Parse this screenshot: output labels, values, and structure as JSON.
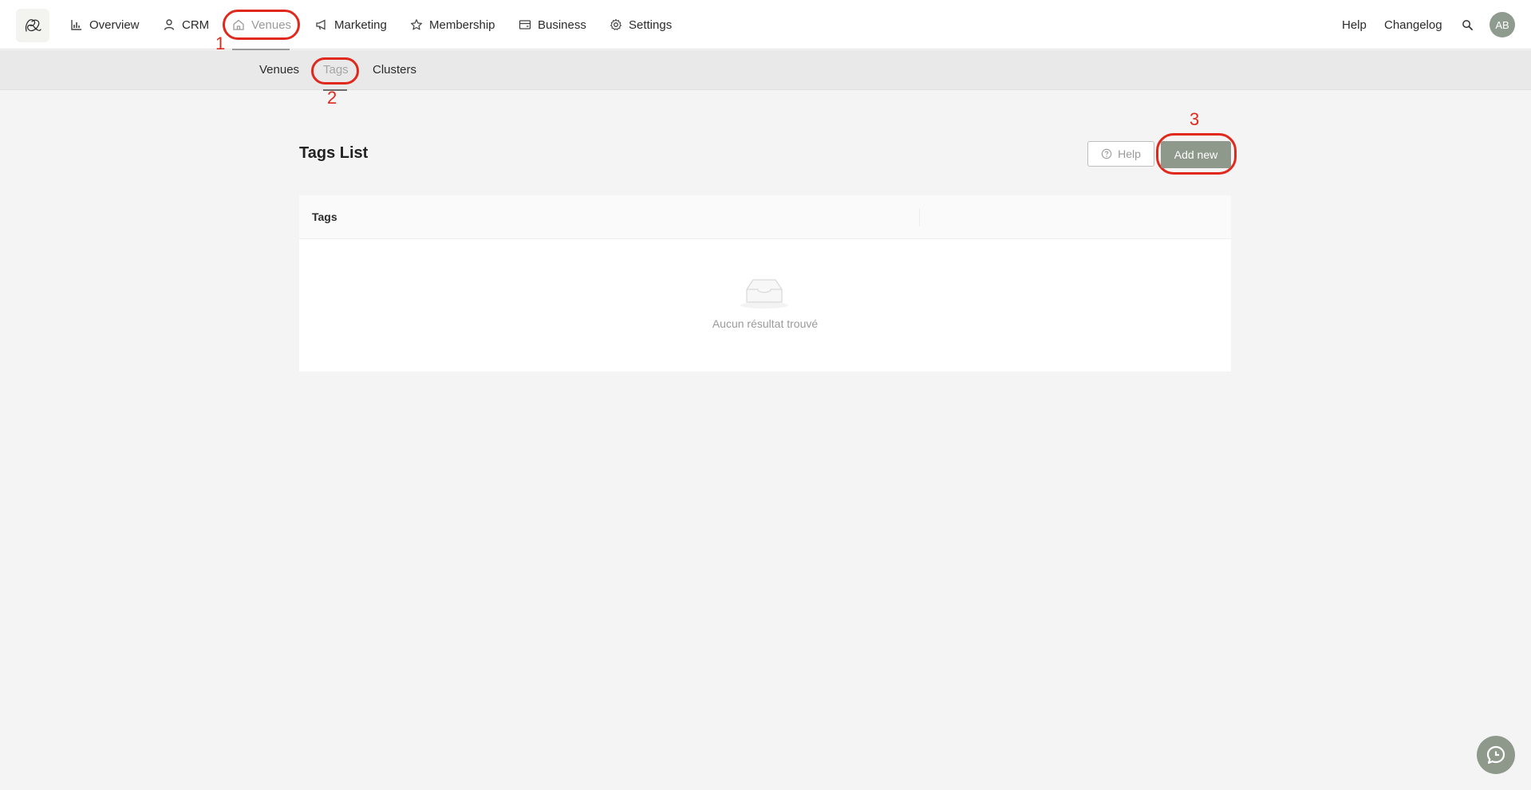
{
  "topnav": {
    "items": [
      {
        "label": "Overview",
        "icon": "chart-icon"
      },
      {
        "label": "CRM",
        "icon": "user-icon"
      },
      {
        "label": "Venues",
        "icon": "home-icon",
        "active": true
      },
      {
        "label": "Marketing",
        "icon": "megaphone-icon"
      },
      {
        "label": "Membership",
        "icon": "star-icon"
      },
      {
        "label": "Business",
        "icon": "card-icon"
      },
      {
        "label": "Settings",
        "icon": "gear-icon"
      }
    ],
    "help_label": "Help",
    "changelog_label": "Changelog",
    "avatar_initials": "AB"
  },
  "subnav": {
    "items": [
      {
        "label": "Venues"
      },
      {
        "label": "Tags",
        "active": true
      },
      {
        "label": "Clusters"
      }
    ]
  },
  "annotations": {
    "one": "1",
    "two": "2",
    "three": "3",
    "color": "#e0281c"
  },
  "page": {
    "title": "Tags List",
    "help_button": "Help",
    "add_button": "Add new"
  },
  "table": {
    "columns": [
      "Tags"
    ],
    "empty_text": "Aucun résultat trouvé"
  },
  "colors": {
    "accent": "#8e998c",
    "annotation": "#e0281c"
  }
}
